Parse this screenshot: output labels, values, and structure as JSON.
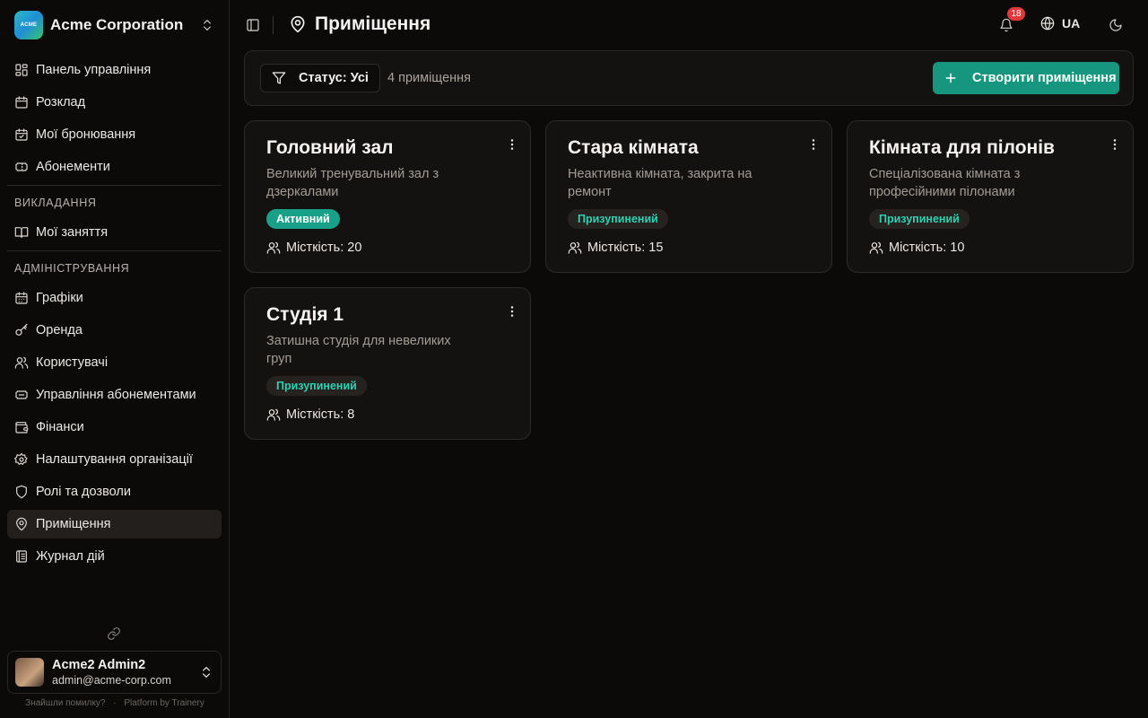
{
  "org": {
    "name": "Acme Corporation",
    "logo_text": "ACME"
  },
  "nav": {
    "main": [
      {
        "label": "Панель управління",
        "icon": "dashboard-icon"
      },
      {
        "label": "Розклад",
        "icon": "calendar-icon"
      },
      {
        "label": "Мої бронювання",
        "icon": "calendar-check-icon"
      },
      {
        "label": "Абонементи",
        "icon": "ticket-icon"
      }
    ],
    "teaching_title": "ВИКЛАДАННЯ",
    "teaching": [
      {
        "label": "Мої заняття",
        "icon": "book-icon"
      }
    ],
    "admin_title": "АДМІНІСТРУВАННЯ",
    "admin": [
      {
        "label": "Графіки",
        "icon": "calendar-grid-icon"
      },
      {
        "label": "Оренда",
        "icon": "key-icon"
      },
      {
        "label": "Користувачі",
        "icon": "users-icon"
      },
      {
        "label": "Управління абонементами",
        "icon": "tickets-icon"
      },
      {
        "label": "Фінанси",
        "icon": "wallet-icon"
      },
      {
        "label": "Налаштування організації",
        "icon": "gear-icon"
      },
      {
        "label": "Ролі та дозволи",
        "icon": "shield-icon"
      },
      {
        "label": "Приміщення",
        "icon": "map-pin-icon",
        "active": true
      },
      {
        "label": "Журнал дій",
        "icon": "log-icon"
      }
    ]
  },
  "user": {
    "name": "Acme2 Admin2",
    "email": "admin@acme-corp.com"
  },
  "footer": {
    "report": "Знайшли помилку?",
    "sep": "·",
    "platform": "Platform by Trainery"
  },
  "header": {
    "title": "Приміщення",
    "notifications": "18",
    "language": "UA"
  },
  "toolbar": {
    "status_filter": "Статус: Усі",
    "count": "4 приміщення",
    "create_label": "Створити приміщення"
  },
  "rooms": [
    {
      "name": "Головний зал",
      "description": "Великий тренувальний зал з дзеркалами",
      "status": "Активний",
      "status_type": "active",
      "capacity": "Місткість: 20"
    },
    {
      "name": "Стара кімната",
      "description": "Неактивна кімната, закрита на ремонт",
      "status": "Призупинений",
      "status_type": "paused",
      "capacity": "Місткість: 15"
    },
    {
      "name": "Кімната для пілонів",
      "description": "Спеціалізована кімната з професійними пілонами",
      "status": "Призупинений",
      "status_type": "paused",
      "capacity": "Місткість: 10"
    },
    {
      "name": "Студія 1",
      "description": "Затишна студія для невеликих груп",
      "status": "Призупинений",
      "status_type": "paused",
      "capacity": "Місткість: 8"
    }
  ],
  "colors": {
    "accent": "#17967f",
    "badge": "#e1383b",
    "paused_text": "#2fd0b0"
  }
}
